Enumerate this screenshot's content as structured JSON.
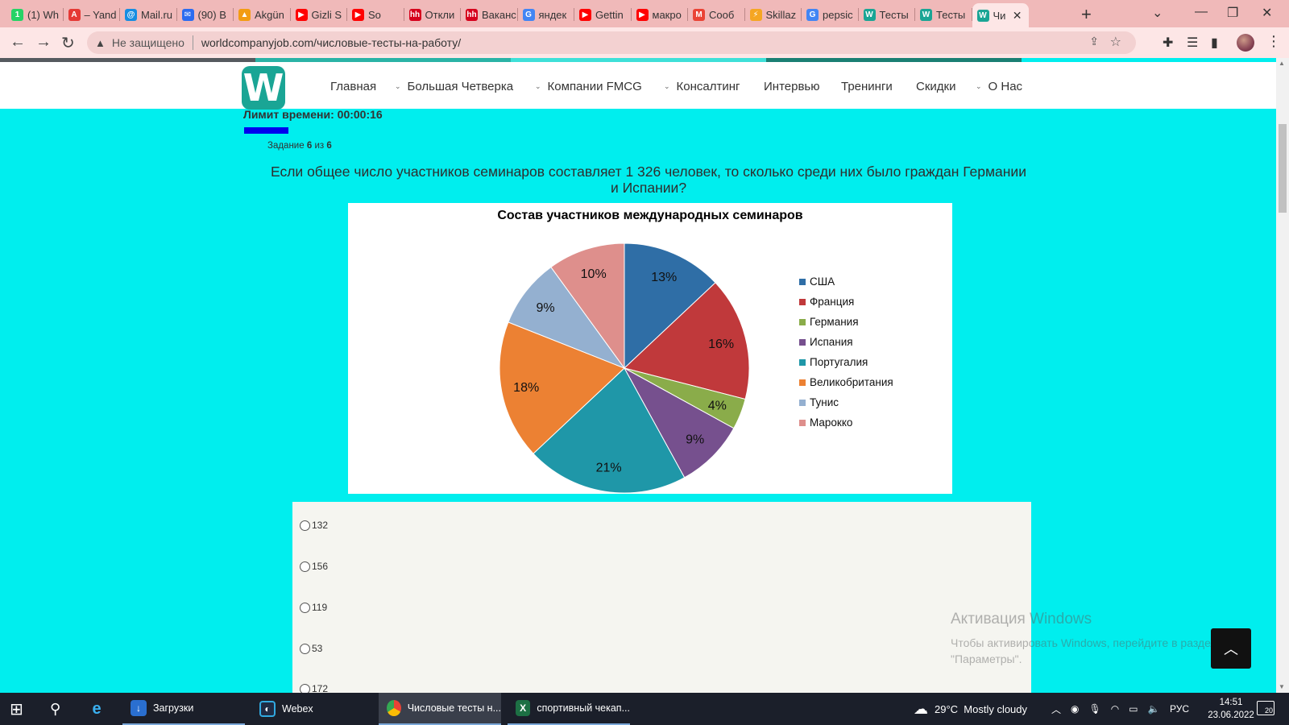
{
  "browser": {
    "tabs": [
      {
        "title": "(1) Wh",
        "icon": "whatsapp-icon",
        "color": "#25d366",
        "glyph": "1"
      },
      {
        "title": "– Yand",
        "icon": "yandex-icon",
        "color": "#e53935",
        "glyph": "A"
      },
      {
        "title": "Mail.ru",
        "icon": "mailru-icon",
        "color": "#168de2",
        "glyph": "@"
      },
      {
        "title": "(90) B",
        "icon": "messenger-icon",
        "color": "#2b6cf0",
        "glyph": "✉"
      },
      {
        "title": "Akgün",
        "icon": "akgun-icon",
        "color": "#f39c12",
        "glyph": "▲"
      },
      {
        "title": "Gizli S",
        "icon": "youtube-icon",
        "color": "#ff0000",
        "glyph": "▶"
      },
      {
        "title": "So",
        "icon": "youtube-icon",
        "color": "#ff0000",
        "glyph": "▶"
      },
      {
        "title": "Откли",
        "icon": "hh-icon",
        "color": "#d6001c",
        "glyph": "hh"
      },
      {
        "title": "Ваканс",
        "icon": "hh-icon",
        "color": "#d6001c",
        "glyph": "hh"
      },
      {
        "title": "яндек",
        "icon": "google-icon",
        "color": "#4285f4",
        "glyph": "G"
      },
      {
        "title": "Gettin",
        "icon": "youtube-icon",
        "color": "#ff0000",
        "glyph": "▶"
      },
      {
        "title": "макро",
        "icon": "youtube-icon",
        "color": "#ff0000",
        "glyph": "▶"
      },
      {
        "title": "Сооб",
        "icon": "gmail-icon",
        "color": "#ea4335",
        "glyph": "M"
      },
      {
        "title": "Skillaz",
        "icon": "skillaz-icon",
        "color": "#f5a623",
        "glyph": "⚡"
      },
      {
        "title": "pepsic",
        "icon": "google-icon",
        "color": "#4285f4",
        "glyph": "G"
      },
      {
        "title": "Тесты",
        "icon": "worldcompanyjob-icon",
        "color": "#1aa595",
        "glyph": "W"
      },
      {
        "title": "Тесты",
        "icon": "worldcompanyjob-icon",
        "color": "#1aa595",
        "glyph": "W"
      },
      {
        "title": "Чи",
        "icon": "worldcompanyjob-icon",
        "color": "#1aa595",
        "glyph": "W"
      }
    ],
    "new_tab": "+",
    "insecure_label": "Не защищено",
    "url": "worldcompanyjob.com/числовые-тесты-на-работу/"
  },
  "site": {
    "logo_letter": "W",
    "menu": [
      {
        "label": "Главная",
        "dropdown": false
      },
      {
        "label": "Большая Четверка",
        "dropdown": true
      },
      {
        "label": "Компании FMCG",
        "dropdown": true
      },
      {
        "label": "Консалтинг",
        "dropdown": true
      },
      {
        "label": "Интервью",
        "dropdown": false
      },
      {
        "label": "Тренинги",
        "dropdown": false
      },
      {
        "label": "Скидки",
        "dropdown": false
      },
      {
        "label": "О Нас",
        "dropdown": true
      }
    ],
    "colorbar": [
      "#555a5f",
      "#2ab3a6",
      "#3ee0d8",
      "#1a7f73"
    ]
  },
  "quiz": {
    "timer_label": "Лимит времени: 00:00:16",
    "task_prefix": "Задание",
    "task_current": "6",
    "task_of": "из",
    "task_total": "6",
    "question": "Если общее число участников семинаров составляет  1 326 человек, то сколько среди них было граждан Германии и Испании?",
    "options": [
      "132",
      "156",
      "119",
      "53",
      "172"
    ]
  },
  "chart_data": {
    "type": "pie",
    "title": "Состав участников международных семинаров",
    "categories": [
      "США",
      "Франция",
      "Германия",
      "Испания",
      "Португалия",
      "Великобритания",
      "Тунис",
      "Марокко"
    ],
    "values": [
      13,
      16,
      4,
      9,
      21,
      18,
      9,
      10
    ],
    "labels": [
      "13%",
      "16%",
      "4%",
      "9%",
      "21%",
      "18%",
      "9%",
      "10%"
    ],
    "colors": [
      "#2f6ea6",
      "#c0393b",
      "#8aac4a",
      "#76508e",
      "#1f97a8",
      "#ec8133",
      "#94b0d0",
      "#de8f8c"
    ],
    "legend": "right"
  },
  "watermark": {
    "title": "Активация Windows",
    "line": "Чтобы активировать Windows, перейдите в раздел \"Параметры\"."
  },
  "taskbar": {
    "apps": [
      {
        "label": "Загрузки",
        "icon": "downloads-folder-icon"
      },
      {
        "label": "Webex",
        "icon": "webex-icon"
      },
      {
        "label": "Числовые тесты н...",
        "icon": "chrome-icon"
      },
      {
        "label": "спортивный чекап...",
        "icon": "excel-icon"
      }
    ],
    "weather": "29°C  Mostly cloudy",
    "lang": "РУС",
    "time": "14:51",
    "date": "23.06.2022",
    "notifications": "20"
  }
}
